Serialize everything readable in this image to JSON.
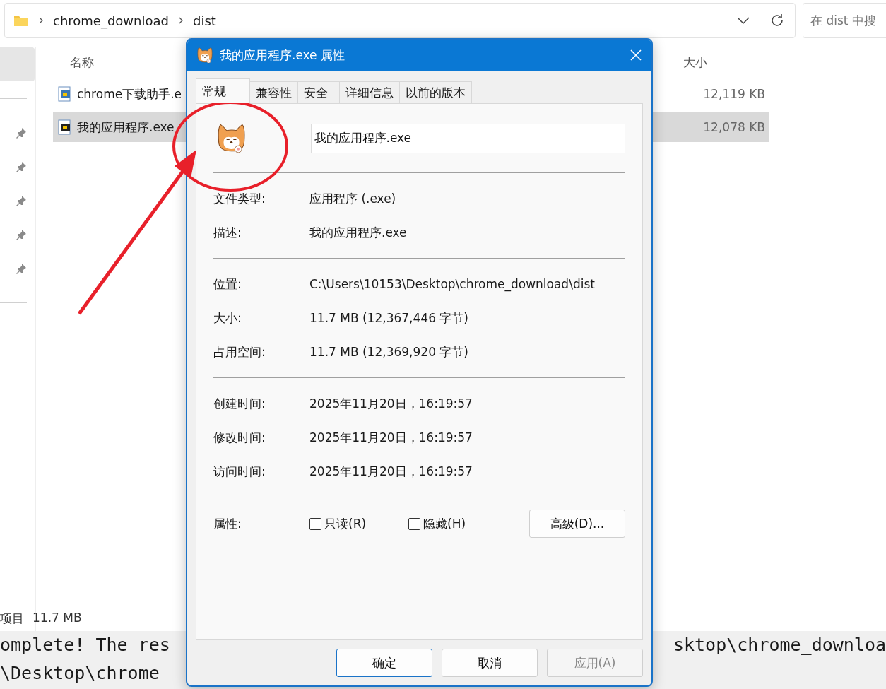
{
  "explorer": {
    "breadcrumb": [
      "chrome_download",
      "dist"
    ],
    "search": {
      "placeholder": "在 dist 中搜"
    },
    "columns": [
      "名称",
      "大小"
    ],
    "files": [
      {
        "name": "chrome下载助手.e",
        "size": "12,119 KB",
        "selected": false
      },
      {
        "name": "我的应用程序.exe",
        "size": "12,078 KB",
        "selected": true
      }
    ],
    "status": {
      "count": "项目",
      "size": "11.7 MB"
    }
  },
  "terminal": {
    "lines": [
      {
        "left": "omplete! The res",
        "right": "sktop\\chrome_downloa"
      },
      {
        "left": "\\Desktop\\chrome_"
      }
    ]
  },
  "dialog": {
    "title": "我的应用程序.exe 属性",
    "tabs": [
      {
        "label": "常规",
        "selected": true
      },
      {
        "label": "兼容性",
        "selected": false
      },
      {
        "label": "安全",
        "selected": false
      },
      {
        "label": "详细信息",
        "selected": false
      },
      {
        "label": "以前的版本",
        "selected": false
      }
    ],
    "name_field": {
      "value": "我的应用程序.exe"
    },
    "groups": [
      [
        {
          "label": "文件类型:",
          "value": "应用程序 (.exe)"
        },
        {
          "label": "描述:",
          "value": "我的应用程序.exe"
        }
      ],
      [
        {
          "label": "位置:",
          "value": "C:\\Users\\10153\\Desktop\\chrome_download\\dist"
        },
        {
          "label": "大小:",
          "value": "11.7 MB (12,367,446 字节)"
        },
        {
          "label": "占用空间:",
          "value": "11.7 MB (12,369,920 字节)"
        }
      ],
      [
        {
          "label": "创建时间:",
          "value": "2025年11月20日，16:19:57"
        },
        {
          "label": "修改时间:",
          "value": "2025年11月20日，16:19:57"
        },
        {
          "label": "访问时间:",
          "value": "2025年11月20日，16:19:57"
        }
      ]
    ],
    "attributes": {
      "label": "属性:",
      "options": [
        {
          "label": "只读(R)",
          "checked": false
        },
        {
          "label": "隐藏(H)",
          "checked": false
        }
      ],
      "advanced_button": "高级(D)..."
    },
    "buttons": [
      {
        "label": "确定",
        "kind": "default",
        "disabled": false
      },
      {
        "label": "取消",
        "kind": "normal",
        "disabled": false
      },
      {
        "label": "应用(A)",
        "kind": "normal",
        "disabled": true
      }
    ]
  }
}
